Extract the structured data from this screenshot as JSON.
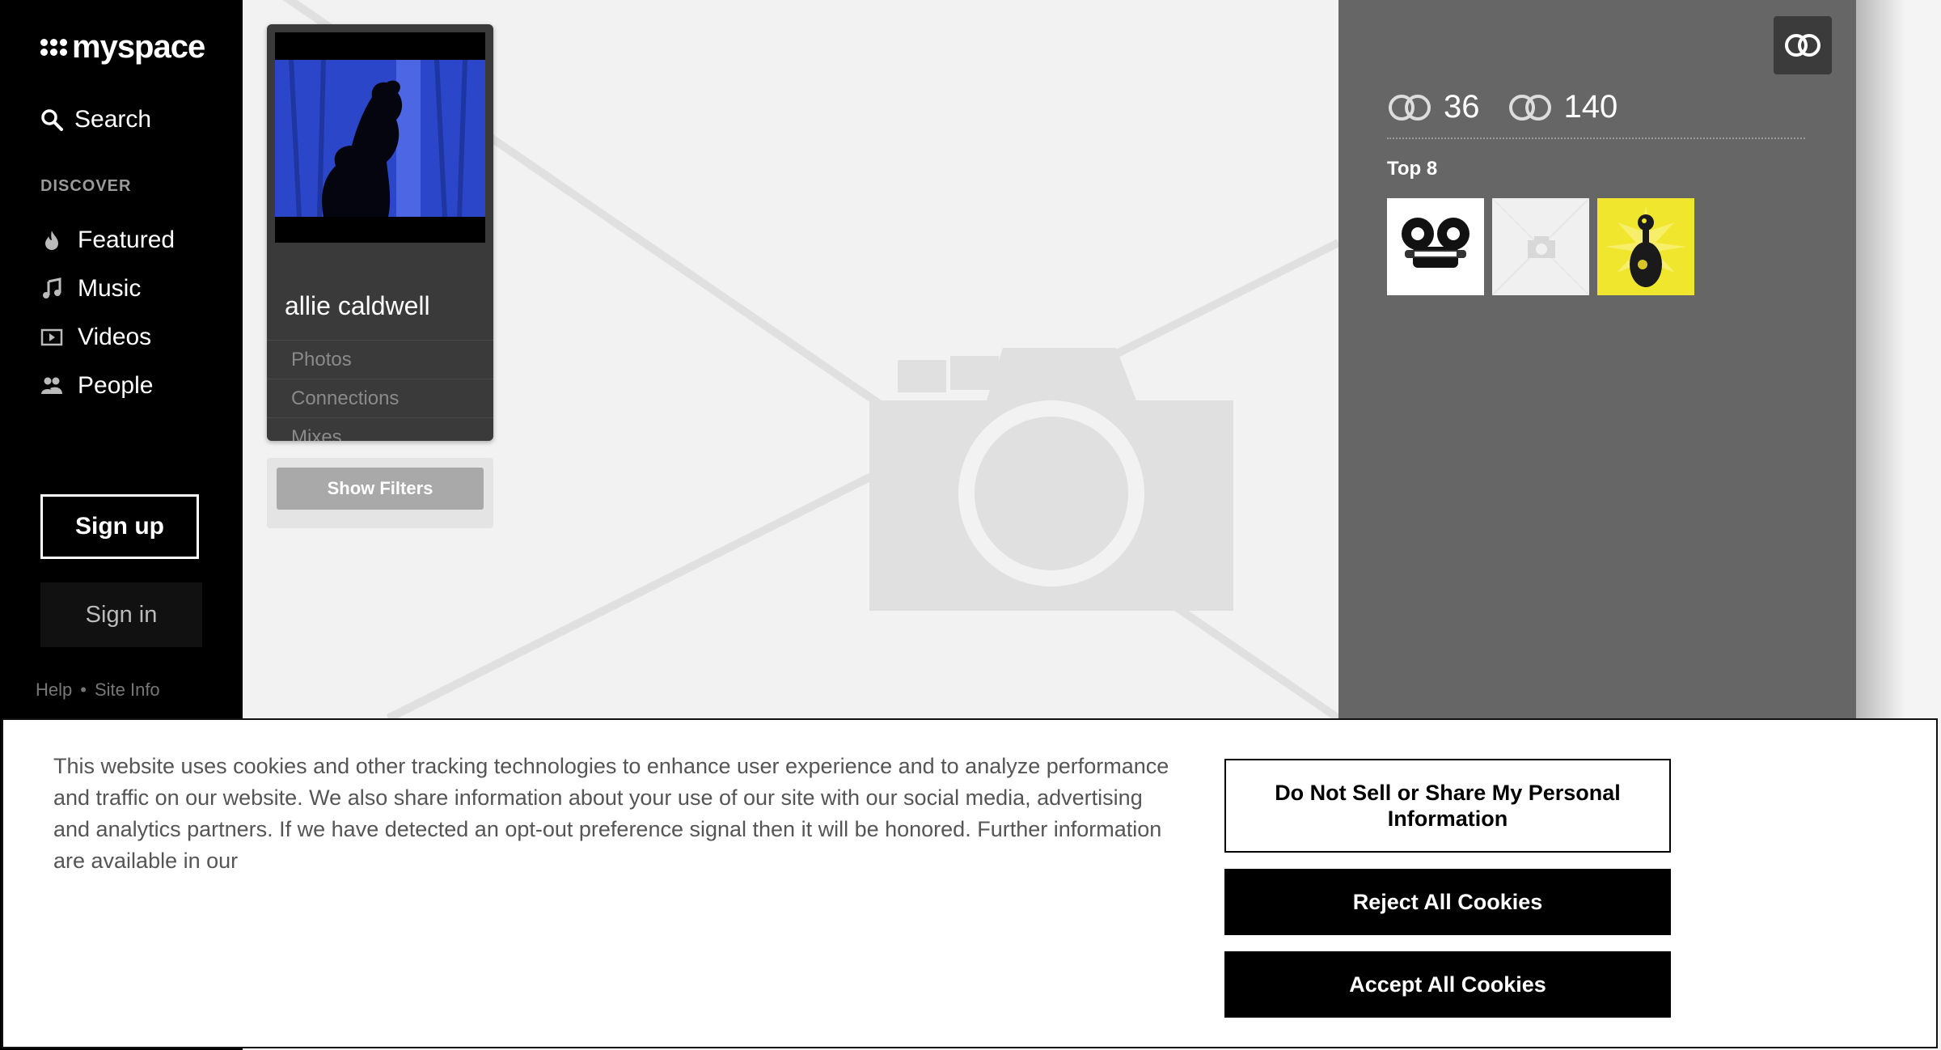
{
  "brand": {
    "name": "myspace"
  },
  "nav": {
    "search_label": "Search",
    "discover_label": "DISCOVER",
    "items": [
      {
        "label": "Featured",
        "icon": "flame-icon"
      },
      {
        "label": "Music",
        "icon": "music-note-icon"
      },
      {
        "label": "Videos",
        "icon": "video-icon"
      },
      {
        "label": "People",
        "icon": "people-icon"
      }
    ],
    "signup_label": "Sign up",
    "signin_label": "Sign in",
    "footer": {
      "help": "Help",
      "separator": "•",
      "site_info": "Site Info"
    }
  },
  "profile": {
    "name": "allie caldwell",
    "links": [
      "Photos",
      "Connections",
      "Mixes"
    ],
    "show_filters_label": "Show Filters"
  },
  "stats": {
    "connections": "36",
    "connected_to": "140"
  },
  "top8": {
    "label": "Top 8"
  },
  "cookie": {
    "text": "This website uses cookies and other tracking technologies to enhance user experience and to analyze performance and traffic on our website. We also share information about your use of our site with our social media, advertising and analytics partners. If we have detected an opt-out preference signal then it will be honored. Further information are available in our",
    "do_not_sell_label": "Do Not Sell or Share My Personal Information",
    "reject_label": "Reject All Cookies",
    "accept_label": "Accept All Cookies"
  },
  "colors": {
    "sidebar": "#000000",
    "panel": "#666666",
    "card": "#3a3a3a",
    "accent_yellow": "#f2e93a"
  }
}
